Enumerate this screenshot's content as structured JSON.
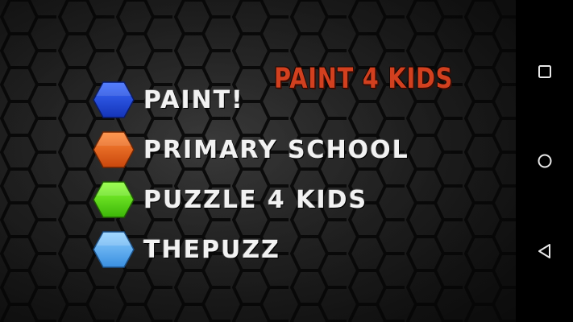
{
  "app": {
    "title": "PAINT 4 KIDS"
  },
  "menu": {
    "items": [
      {
        "label": "PAINT!",
        "icon": "blue-hexagon-icon",
        "color": "#1f4fe0"
      },
      {
        "label": "PRIMARY SCHOOL",
        "icon": "orange-hexagon-icon",
        "color": "#ee6a1c"
      },
      {
        "label": "PUZZLE 4 KIDS",
        "icon": "green-hexagon-icon",
        "color": "#55dd10"
      },
      {
        "label": "THEPUZZ",
        "icon": "light-blue-hexagon-icon",
        "color": "#4aa6f0"
      }
    ]
  },
  "navbar": {
    "buttons": [
      {
        "icon": "recent-apps-square-icon"
      },
      {
        "icon": "home-circle-icon"
      },
      {
        "icon": "back-triangle-icon"
      }
    ]
  },
  "colors": {
    "title": "#d2401f",
    "background": "#2a2a2a",
    "navbar": "#000000"
  }
}
